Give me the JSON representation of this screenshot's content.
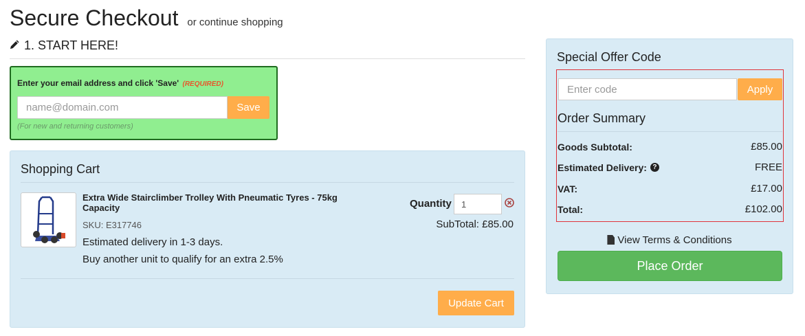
{
  "header": {
    "title": "Secure Checkout",
    "continue_link": "or continue shopping",
    "step_title": "1. START HERE!"
  },
  "email": {
    "label": "Enter your email address and click 'Save'",
    "required": "(REQUIRED)",
    "placeholder": "name@domain.com",
    "save_label": "Save",
    "note": "(For new and returning customers)"
  },
  "cart": {
    "heading": "Shopping Cart",
    "item": {
      "name": "Extra Wide Stairclimber Trolley With Pneumatic Tyres - 75kg Capacity",
      "sku": "SKU: E317746",
      "delivery": "Estimated delivery in 1-3 days.",
      "offer": "Buy another unit to qualify for an extra 2.5%",
      "quantity_label": "Quantity",
      "quantity": "1",
      "subtotal": "SubTotal: £85.00"
    },
    "update_label": "Update Cart"
  },
  "offer": {
    "title": "Special Offer Code",
    "placeholder": "Enter code",
    "apply_label": "Apply"
  },
  "summary": {
    "title": "Order Summary",
    "rows": [
      {
        "label": "Goods Subtotal:",
        "value": "£85.00"
      },
      {
        "label": "Estimated Delivery:",
        "value": "FREE"
      },
      {
        "label": "VAT:",
        "value": "£17.00"
      },
      {
        "label": "Total:",
        "value": "£102.00"
      }
    ],
    "terms": "View Terms & Conditions",
    "place_order": "Place Order"
  },
  "colors": {
    "accent_orange": "#ffad4a",
    "email_bg": "#90ee90",
    "panel_bg": "#d9ebf5",
    "place_order_green": "#5cb85c",
    "highlight_red": "#e0333a"
  },
  "icons": {
    "step": "pencil-icon",
    "remove": "remove-circle-icon",
    "help": "question-circle-icon",
    "terms": "file-text-icon"
  }
}
